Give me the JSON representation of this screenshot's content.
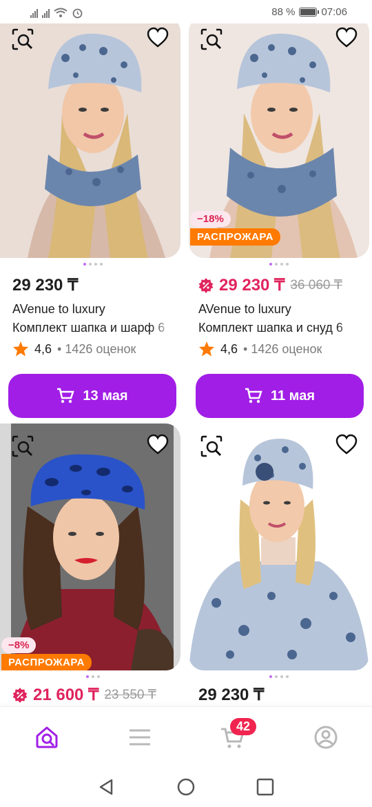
{
  "status_bar": {
    "battery": "88 %",
    "battery_level": 0.88,
    "time": "07:06",
    "icons": [
      "signal-icon",
      "signal-icon",
      "wifi-icon",
      "alarm-icon",
      "battery-icon"
    ]
  },
  "products": [
    {
      "price": "29 230 ₸",
      "old_price": "",
      "discount": "",
      "sale_label": "",
      "brand": "AVenue to luxury",
      "title": "Комплект шапка и шарф 6",
      "rating": "4,6",
      "reviews": "• 1426 оценок",
      "delivery": "13 мая",
      "images_total": 4,
      "image_active": 1,
      "image_desc_colors": [
        "#e9ddd6",
        "#4b6790"
      ]
    },
    {
      "price": "29 230 ₸",
      "old_price": "36 060 ₸",
      "discount": "−18%",
      "sale_label": "РАСПРОЖАРА",
      "brand": "AVenue to luxury",
      "title": "Комплект шапка и снуд 6",
      "rating": "4,6",
      "reviews": "• 1426 оценок",
      "delivery": "11 мая",
      "images_total": 4,
      "image_active": 1,
      "image_desc_colors": [
        "#efe6e1",
        "#4b6790"
      ]
    },
    {
      "price": "21 600 ₸",
      "old_price": "23 550 ₸",
      "discount": "−8%",
      "sale_label": "РАСПРОЖАРА",
      "images_total": 3,
      "image_active": 1,
      "image_desc_colors": [
        "#6f6f6f",
        "#2a53c9"
      ]
    },
    {
      "price": "29 230 ₸",
      "old_price": "",
      "discount": "",
      "sale_label": "",
      "images_total": 4,
      "image_active": 1,
      "image_desc_colors": [
        "#ffffff",
        "#4b6790"
      ]
    }
  ],
  "bottom_nav": {
    "items": [
      "home-search-icon",
      "catalog-icon",
      "cart-icon",
      "profile-icon"
    ],
    "cart_count": "42",
    "active": "home-search-icon"
  },
  "colors": {
    "accent": "#a11ee6",
    "sale_price": "#e0245e",
    "sale_badge": "#ff7a00",
    "star": "#ff7a00"
  }
}
